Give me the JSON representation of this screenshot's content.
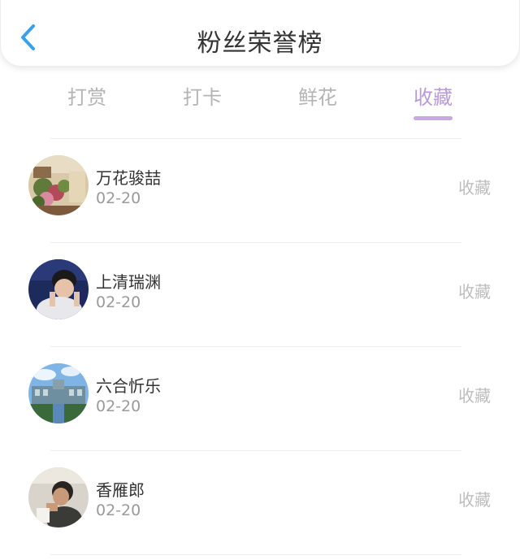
{
  "header": {
    "title": "粉丝荣誉榜"
  },
  "tabs": [
    {
      "label": "打赏",
      "active": false
    },
    {
      "label": "打卡",
      "active": false
    },
    {
      "label": "鲜花",
      "active": false
    },
    {
      "label": "收藏",
      "active": true
    }
  ],
  "list": [
    {
      "name": "万花骏喆",
      "date": "02-20",
      "action": "收藏"
    },
    {
      "name": "上清瑞渊",
      "date": "02-20",
      "action": "收藏"
    },
    {
      "name": "六合忻乐",
      "date": "02-20",
      "action": "收藏"
    },
    {
      "name": "香雁郎",
      "date": "02-20",
      "action": "收藏"
    }
  ],
  "colors": {
    "accent": "#b89ad6",
    "back_icon": "#3aa0e8",
    "inactive_tab": "#b4b4b4"
  }
}
